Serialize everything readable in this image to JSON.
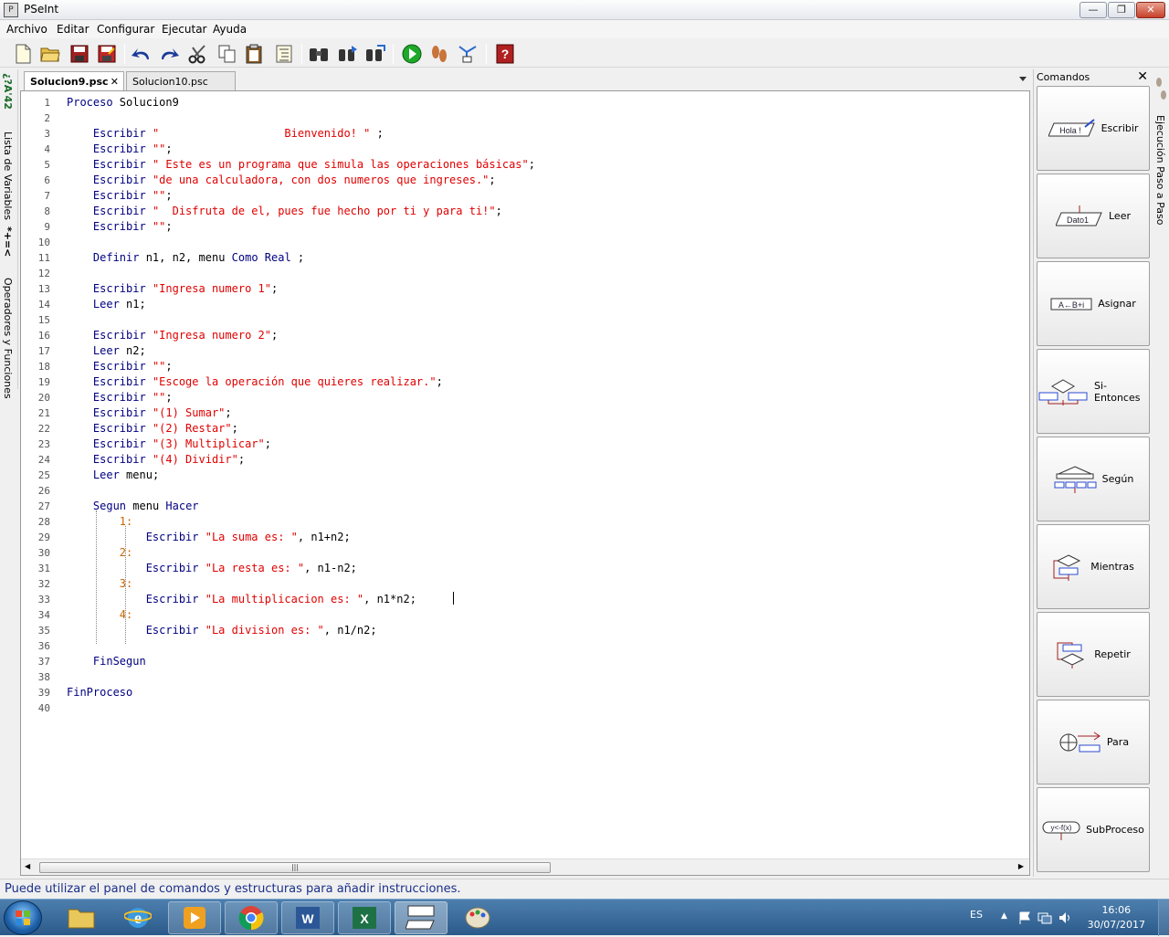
{
  "window": {
    "title": "PSeInt",
    "minimize": "—",
    "restore": "❐",
    "close": "✕"
  },
  "menu": [
    "Archivo",
    "Editar",
    "Configurar",
    "Ejecutar",
    "Ayuda"
  ],
  "left_panel": {
    "variables_label": "Lista de Variables",
    "variables_glyphs": "*+=<",
    "operators_label": "Operadores y Funciones"
  },
  "left_panel_top_glyphs": "¿?A'42",
  "tabs": [
    {
      "label": "Solucion9.psc",
      "active": true,
      "close": "✕"
    },
    {
      "label": "Solucion10.psc",
      "active": false
    }
  ],
  "editor": {
    "lines": [
      "Proceso Solucion9",
      "",
      "    Escribir \"                   Bienvenido! \" ;",
      "    Escribir \"\";",
      "    Escribir \" Este es un programa que simula las operaciones básicas\";",
      "    Escribir \"de una calculadora, con dos numeros que ingreses.\";",
      "    Escribir \"\";",
      "    Escribir \"  Disfruta de el, pues fue hecho por ti y para ti!\";",
      "    Escribir \"\";",
      "",
      "    Definir n1, n2, menu Como Real ;",
      "",
      "    Escribir \"Ingresa numero 1\";",
      "    Leer n1;",
      "",
      "    Escribir \"Ingresa numero 2\";",
      "    Leer n2;",
      "    Escribir \"\";",
      "    Escribir \"Escoge la operación que quieres realizar.\";",
      "    Escribir \"\";",
      "    Escribir \"(1) Sumar\";",
      "    Escribir \"(2) Restar\";",
      "    Escribir \"(3) Multiplicar\";",
      "    Escribir \"(4) Dividir\";",
      "    Leer menu;",
      "",
      "    Segun menu Hacer",
      "        1:",
      "            Escribir \"La suma es: \", n1+n2;",
      "        2:",
      "            Escribir \"La resta es: \", n1-n2;",
      "        3:",
      "            Escribir \"La multiplicacion es: \", n1*n2;",
      "        4:",
      "            Escribir \"La division es: \", n1/n2;",
      "",
      "    FinSegun",
      "",
      "FinProceso",
      ""
    ],
    "hscroll_grip": "|||"
  },
  "commands_panel": {
    "title": "Comandos",
    "close": "✕",
    "items": [
      {
        "label": "Escribir",
        "icon": "escribir-icon",
        "icon_text": "Hola !"
      },
      {
        "label": "Leer",
        "icon": "leer-icon",
        "icon_text": "Dato1"
      },
      {
        "label": "Asignar",
        "icon": "asignar-icon",
        "icon_text": "A←B+i"
      },
      {
        "label": "Si-Entonces",
        "icon": "si-entonces-icon"
      },
      {
        "label": "Según",
        "icon": "segun-icon"
      },
      {
        "label": "Mientras",
        "icon": "mientras-icon"
      },
      {
        "label": "Repetir",
        "icon": "repetir-icon"
      },
      {
        "label": "Para",
        "icon": "para-icon"
      },
      {
        "label": "SubProceso",
        "icon": "subproceso-icon",
        "icon_text": "y<-f(x)"
      }
    ]
  },
  "right_tab": {
    "label": "Ejecución Paso a Paso"
  },
  "status": {
    "text": "Puede utilizar el panel de comandos y estructuras para añadir instrucciones."
  },
  "taskbar": {
    "apps": [
      "explorer-icon",
      "internet-explorer-icon",
      "media-player-icon",
      "chrome-icon",
      "word-icon",
      "excel-icon",
      "pseint-icon",
      "paint-icon"
    ],
    "lang": "ES",
    "time": "16:06",
    "date": "30/07/2017"
  },
  "colors": {
    "keyword": "#000080",
    "string": "#e00000",
    "number": "#c86400",
    "status_text": "#1a2f8a"
  }
}
